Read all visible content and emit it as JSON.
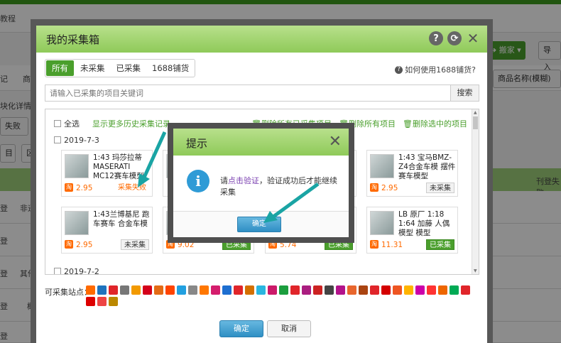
{
  "background": {
    "tutorial_text": "教程",
    "col_labels": [
      "记",
      "商",
      "",
      "",
      ""
    ],
    "left_fragments": [
      "块化详情",
      "失败",
      "目",
      "区"
    ],
    "row_labels": [
      "登",
      "登",
      "登",
      "登",
      "登"
    ],
    "row_extra": [
      "非遥",
      "",
      "其他",
      "概",
      ""
    ],
    "move_btn": "搬家",
    "import_btn": "导入",
    "product_name_select": "商品名称(模糊)",
    "col_header_right": "刊登失败"
  },
  "dialog": {
    "title": "我的采集箱",
    "tabs": [
      "所有",
      "未采集",
      "已采集",
      "1688铺货"
    ],
    "help_link": "如何使用1688铺货?",
    "search_placeholder": "请输入已采集的项目关键词",
    "search_button": "搜索",
    "select_all": "全选",
    "more_history": "显示更多历史采集记录",
    "action_delete_collected": "删除所有已采集项目",
    "action_delete_all": "删除所有项目",
    "action_delete_selected": "删除选中的项目",
    "date1": "2019-7-3",
    "date2": "2019-7-2",
    "cards": [
      {
        "name": "1:43 玛莎拉蒂 MASERATI MC12赛车模型",
        "price": "2.95",
        "status": "采集失败"
      },
      {
        "name": "",
        "price": "",
        "status": ""
      },
      {
        "name": "",
        "price": "",
        "status": ""
      },
      {
        "name": "1:43 宝马BMZ-Z4合金车模 摆件赛车模型",
        "price": "2.95",
        "status": "未采集"
      },
      {
        "name": "1:43兰博基尼 跑车赛车 合金车模",
        "price": "2.95",
        "status": "未采集"
      },
      {
        "name": "",
        "price": "9.02",
        "status": "已采集"
      },
      {
        "name": "",
        "price": "5.74",
        "status": "已采集"
      },
      {
        "name": "LB 原厂 1:18 1:64 加藤 人偶模型 模型",
        "price": "11.31",
        "status": "已采集"
      }
    ],
    "tb_badge": "淘",
    "sites_label": "可采集站点：",
    "ok_button": "确定",
    "cancel_button": "取消"
  },
  "tip": {
    "title": "提示",
    "msg_prefix": "请",
    "msg_link": "点击验证",
    "msg_suffix": "，验证成功后才能继续采集",
    "ok_button": "确定"
  },
  "colors": {
    "green": "#4a9f2c",
    "title_green": "#8fca59",
    "blue": "#2f9bd6",
    "orange": "#ff6a00",
    "arrow": "#1aa4a4"
  }
}
